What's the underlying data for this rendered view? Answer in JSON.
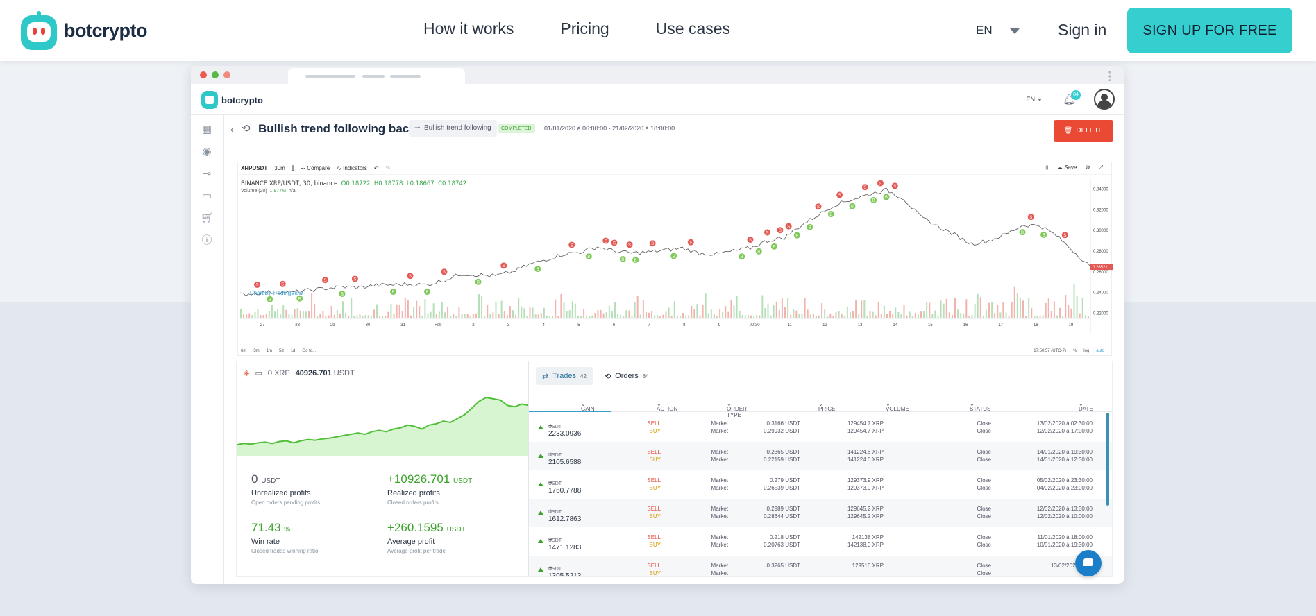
{
  "site": {
    "brand": "botcrypto",
    "nav": [
      "How it works",
      "Pricing",
      "Use cases"
    ],
    "lang": "EN",
    "signin": "Sign in",
    "signup": "SIGN UP FOR FREE",
    "accent": "#35cfd0"
  },
  "app": {
    "brand": "botcrypto",
    "lang": "EN",
    "notifications": "84"
  },
  "backtest": {
    "title": "Bullish trend following backtest",
    "strategy": "Bullish trend following",
    "status": "COMPLETED",
    "period": "01/01/2020 à 06:00:00 - 21/02/2020 à 18:00:00",
    "delete": "DELETE"
  },
  "chart": {
    "toolbar": {
      "symbol": "XRPUSDT",
      "interval": "30m",
      "compare": "Compare",
      "indicators": "Indicators",
      "save": "Save"
    },
    "legend": {
      "pair": "BINANCE XRP/USDT, 30, binance",
      "o": "O0.18722",
      "h": "H0.18778",
      "l": "L0.18667",
      "c": "C0.18742",
      "volume_label": "Volume (20)",
      "volume_value": "1.977M",
      "volume_na": "n/a"
    },
    "credit": "Chart by TradingView",
    "ranges": [
      "6m",
      "3m",
      "1m",
      "5d",
      "1d",
      "Go to..."
    ],
    "status": [
      "17:50:57 (UTC-7)",
      "%",
      "log",
      "auto"
    ]
  },
  "chart_data": {
    "type": "line",
    "title": "BINANCE XRP/USDT, 30, binance",
    "x_ticks": [
      "27",
      "28",
      "29",
      "30",
      "31",
      "Feb",
      "2",
      "3",
      "4",
      "5",
      "6",
      "7",
      "8",
      "9",
      "00:30",
      "11",
      "12",
      "13",
      "14",
      "15",
      "16",
      "17",
      "18",
      "19"
    ],
    "y_ticks": [
      "0.34000",
      "0.32000",
      "0.30000",
      "0.28000",
      "0.26000",
      "0.24000",
      "0.22000"
    ],
    "ylim": [
      0.215,
      0.351
    ],
    "last_price": "0.26521",
    "series": [
      {
        "x": [
          0,
          2,
          4,
          6,
          8,
          10,
          12,
          14,
          16,
          18,
          20,
          22,
          24,
          26,
          28,
          30,
          32,
          34,
          36,
          38,
          40,
          42,
          44,
          46,
          48,
          50,
          52,
          54,
          56,
          58,
          60,
          62,
          64,
          66,
          68,
          70,
          72,
          74,
          76,
          78,
          80,
          82,
          84,
          86,
          88,
          90,
          92,
          94,
          96,
          98,
          100
        ],
        "values": [
          0.238,
          0.2395,
          0.2405,
          0.24,
          0.242,
          0.244,
          0.2455,
          0.245,
          0.247,
          0.2475,
          0.248,
          0.2475,
          0.252,
          0.258,
          0.257,
          0.256,
          0.26,
          0.267,
          0.272,
          0.277,
          0.279,
          0.284,
          0.28,
          0.278,
          0.279,
          0.281,
          0.283,
          0.278,
          0.277,
          0.28,
          0.283,
          0.29,
          0.293,
          0.305,
          0.315,
          0.325,
          0.33,
          0.335,
          0.339,
          0.331,
          0.313,
          0.304,
          0.296,
          0.287,
          0.29,
          0.296,
          0.305,
          0.305,
          0.295,
          0.28,
          0.265
        ]
      }
    ],
    "signals": [
      {
        "x": 2,
        "s": "S"
      },
      {
        "x": 3.5,
        "s": "B"
      },
      {
        "x": 5,
        "s": "S"
      },
      {
        "x": 7,
        "s": "B"
      },
      {
        "x": 10,
        "s": "S"
      },
      {
        "x": 12,
        "s": "B"
      },
      {
        "x": 13.5,
        "s": "S"
      },
      {
        "x": 18,
        "s": "B"
      },
      {
        "x": 20,
        "s": "S"
      },
      {
        "x": 22,
        "s": "B"
      },
      {
        "x": 24,
        "s": "S"
      },
      {
        "x": 28,
        "s": "B"
      },
      {
        "x": 31,
        "s": "S"
      },
      {
        "x": 35,
        "s": "B"
      },
      {
        "x": 39,
        "s": "S"
      },
      {
        "x": 41,
        "s": "B"
      },
      {
        "x": 43,
        "s": "S"
      },
      {
        "x": 44,
        "s": "S"
      },
      {
        "x": 45,
        "s": "B"
      },
      {
        "x": 45.8,
        "s": "S"
      },
      {
        "x": 46.5,
        "s": "B"
      },
      {
        "x": 48.5,
        "s": "S"
      },
      {
        "x": 51,
        "s": "B"
      },
      {
        "x": 53,
        "s": "S"
      },
      {
        "x": 59,
        "s": "B"
      },
      {
        "x": 60,
        "s": "S"
      },
      {
        "x": 61,
        "s": "B"
      },
      {
        "x": 62,
        "s": "S"
      },
      {
        "x": 62.8,
        "s": "B"
      },
      {
        "x": 63.5,
        "s": "S"
      },
      {
        "x": 64.5,
        "s": "S"
      },
      {
        "x": 65.5,
        "s": "B"
      },
      {
        "x": 67,
        "s": "B"
      },
      {
        "x": 68,
        "s": "S"
      },
      {
        "x": 69.5,
        "s": "B"
      },
      {
        "x": 70.5,
        "s": "S"
      },
      {
        "x": 72,
        "s": "B"
      },
      {
        "x": 73.5,
        "s": "S"
      },
      {
        "x": 74.5,
        "s": "B"
      },
      {
        "x": 75.3,
        "s": "S"
      },
      {
        "x": 76,
        "s": "B"
      },
      {
        "x": 77,
        "s": "S"
      },
      {
        "x": 92,
        "s": "B"
      },
      {
        "x": 93,
        "s": "S"
      },
      {
        "x": 94.5,
        "s": "B"
      },
      {
        "x": 97,
        "s": "S"
      }
    ]
  },
  "balance": {
    "xrp": "0",
    "xrp_unit": "XRP",
    "usdt": "40926.701",
    "usdt_unit": "USDT"
  },
  "equity_curve": [
    2,
    3,
    2.5,
    3.5,
    4,
    3,
    4.5,
    5,
    3.5,
    5,
    6,
    5.5,
    6.5,
    7,
    8,
    9,
    10,
    11,
    10,
    12,
    13,
    12,
    14,
    15,
    17,
    16,
    14,
    17,
    18,
    20,
    19,
    22,
    25,
    30,
    35,
    38,
    37,
    36,
    32,
    31,
    33,
    32
  ],
  "stats": [
    {
      "value": "0",
      "unit": "USDT",
      "label": "Unrealized profits",
      "sub": "Open orders pending profits"
    },
    {
      "value": "+10926.701",
      "unit": "USDT",
      "label": "Realized profits",
      "sub": "Closed orders profits"
    },
    {
      "value": "71.43",
      "unit": "%",
      "label": "Win rate",
      "sub": "Closed trades winning ratio"
    },
    {
      "value": "+260.1595",
      "unit": "USDT",
      "label": "Average profit",
      "sub": "Average profit per trade"
    }
  ],
  "trades_tab": {
    "trades": "Trades",
    "trades_count": "42",
    "orders": "Orders",
    "orders_count": "84"
  },
  "columns": [
    "GAIN",
    "ACTION",
    "ORDER TYPE",
    "PRICE",
    "VOLUME",
    "STATUS",
    "DATE"
  ],
  "trades": [
    {
      "gain": "+ 2233.0936",
      "unit": "USDT",
      "a1": "SELL",
      "a2": "BUY",
      "t1": "Market",
      "t2": "Market",
      "p1": "0.3166 USDT",
      "p2": "0.29932 USDT",
      "v1": "129454.7 XRP",
      "v2": "129454.7 XRP",
      "s1": "Close",
      "s2": "Close",
      "d1": "13/02/2020 à 02:30:00",
      "d2": "12/02/2020 à 17:00:00"
    },
    {
      "gain": "+ 2105.6588",
      "unit": "USDT",
      "a1": "SELL",
      "a2": "BUY",
      "t1": "Market",
      "t2": "Market",
      "p1": "0.2365 USDT",
      "p2": "0.22159 USDT",
      "v1": "141224.6 XRP",
      "v2": "141224.6 XRP",
      "s1": "Close",
      "s2": "Close",
      "d1": "14/01/2020 à 19:30:00",
      "d2": "14/01/2020 à 12:30:00"
    },
    {
      "gain": "+ 1760.7788",
      "unit": "USDT",
      "a1": "SELL",
      "a2": "BUY",
      "t1": "Market",
      "t2": "Market",
      "p1": "0.279 USDT",
      "p2": "0.26539 USDT",
      "v1": "129373.9 XRP",
      "v2": "129373.9 XRP",
      "s1": "Close",
      "s2": "Close",
      "d1": "05/02/2020 à 23:30:00",
      "d2": "04/02/2020 à 23:00:00"
    },
    {
      "gain": "+ 1612.7863",
      "unit": "USDT",
      "a1": "SELL",
      "a2": "BUY",
      "t1": "Market",
      "t2": "Market",
      "p1": "0.2989 USDT",
      "p2": "0.28644 USDT",
      "v1": "129645.2 XRP",
      "v2": "129645.2 XRP",
      "s1": "Close",
      "s2": "Close",
      "d1": "12/02/2020 à 13:30:00",
      "d2": "12/02/2020 à 10:00:00"
    },
    {
      "gain": "+ 1471.1283",
      "unit": "USDT",
      "a1": "SELL",
      "a2": "BUY",
      "t1": "Market",
      "t2": "Market",
      "p1": "0.218 USDT",
      "p2": "0.20763 USDT",
      "v1": "142138 XRP",
      "v2": "142138.0 XRP",
      "s1": "Close",
      "s2": "Close",
      "d1": "11/01/2020 à 18:00:00",
      "d2": "10/01/2020 à 19:30:00"
    },
    {
      "gain": "+ 1305.5213",
      "unit": "USDT",
      "a1": "SELL",
      "a2": "BUY",
      "t1": "Market",
      "t2": "Market",
      "p1": "0.3265 USDT",
      "p2": "",
      "v1": "129516 XRP",
      "v2": "",
      "s1": "Close",
      "s2": "Close",
      "d1": "13/02/2020 à 14:",
      "d2": ""
    }
  ]
}
